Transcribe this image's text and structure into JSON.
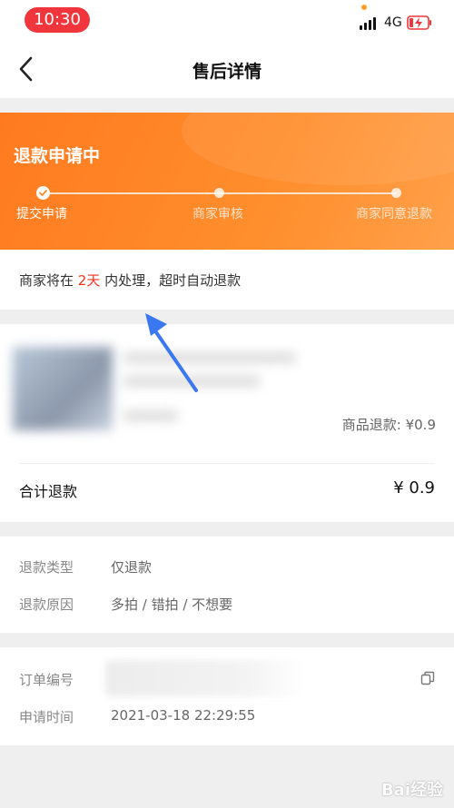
{
  "status_bar": {
    "time": "10:30",
    "network": "4G"
  },
  "nav": {
    "title": "售后详情"
  },
  "hero": {
    "title": "退款申请中",
    "steps": [
      {
        "label": "提交申请",
        "state": "done"
      },
      {
        "label": "商家审核",
        "state": "pending"
      },
      {
        "label": "商家同意退款",
        "state": "pending"
      }
    ]
  },
  "notice": {
    "prefix": "商家将在 ",
    "days": "2天",
    "suffix": " 内处理，超时自动退款"
  },
  "goods": {
    "item_refund": "商品退款: ¥0.9",
    "total_label": "合计退款",
    "total_value": "¥ 0.9"
  },
  "refund_info": {
    "rows": [
      {
        "label": "退款类型",
        "value": "仅退款"
      },
      {
        "label": "退款原因",
        "value": "多拍 / 错拍 / 不想要"
      }
    ]
  },
  "order": {
    "number_label": "订单编号",
    "time_label": "申请时间",
    "time_value": "2021-03-18 22:29:55"
  },
  "watermark": "Bai经验",
  "colors": {
    "accent": "#ff7a1f",
    "highlight": "#f5331f",
    "time_pill": "#f0363c",
    "annotation_arrow": "#3a78f2"
  },
  "icons": {
    "back": "chevron-left-icon",
    "copy": "copy-icon",
    "check": "check-icon"
  }
}
